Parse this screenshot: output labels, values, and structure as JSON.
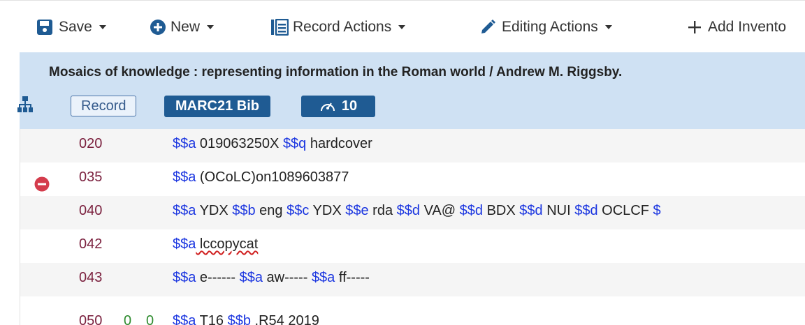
{
  "toolbar": {
    "save_label": "Save",
    "new_label": "New",
    "record_actions_label": "Record Actions",
    "editing_actions_label": "Editing Actions",
    "add_inventory_label": "Add Invento"
  },
  "record": {
    "title": "Mosaics of knowledge : representing information in the Roman world / Andrew M. Riggsby.",
    "badge_record": "Record",
    "badge_format": "MARC21 Bib",
    "badge_score": "10"
  },
  "fields": [
    {
      "tag": "020",
      "ind1": "",
      "ind2": "",
      "content": [
        [
          "$$a",
          " 019063250X "
        ],
        [
          "$$q",
          " hardcover"
        ]
      ]
    },
    {
      "tag": "035",
      "ind1": "",
      "ind2": "",
      "content": [
        [
          "$$a",
          " (OCoLC)on1089603877"
        ]
      ]
    },
    {
      "tag": "040",
      "ind1": "",
      "ind2": "",
      "content": [
        [
          "$$a",
          " YDX "
        ],
        [
          "$$b",
          " eng "
        ],
        [
          "$$c",
          " YDX "
        ],
        [
          "$$e",
          " rda "
        ],
        [
          "$$d",
          " VA@ "
        ],
        [
          "$$d",
          " BDX "
        ],
        [
          "$$d",
          " NUI "
        ],
        [
          "$$d",
          " OCLCF "
        ],
        [
          "$",
          ""
        ]
      ]
    },
    {
      "tag": "042",
      "ind1": "",
      "ind2": "",
      "content": [
        [
          "$$a",
          " lccopycat"
        ]
      ]
    },
    {
      "tag": "043",
      "ind1": "",
      "ind2": "",
      "content": [
        [
          "$$a",
          " e------ "
        ],
        [
          "$$a",
          " aw----- "
        ],
        [
          "$$a",
          " ff-----"
        ]
      ]
    },
    {
      "tag": "050",
      "ind1": "0",
      "ind2": "0",
      "content": [
        [
          "$$a",
          " T16 "
        ],
        [
          "$$b",
          " .R54 2019"
        ]
      ]
    }
  ],
  "colors": {
    "header_bg": "#cfe1f3",
    "badge_bg": "#1f5b93",
    "tag_color": "#7a1f3d",
    "subfield_color": "#1a35e0",
    "indicator_color": "#2e8b2e",
    "delete_icon": "#d43c4c"
  },
  "icons": {
    "save": "floppy-disk-icon",
    "new": "plus-circle-icon",
    "record_actions": "list-box-icon",
    "editing_actions": "pencil-icon",
    "add_inventory": "plus-icon",
    "hierarchy": "hierarchy-icon",
    "score": "gauge-icon",
    "remove": "minus-circle-icon"
  }
}
